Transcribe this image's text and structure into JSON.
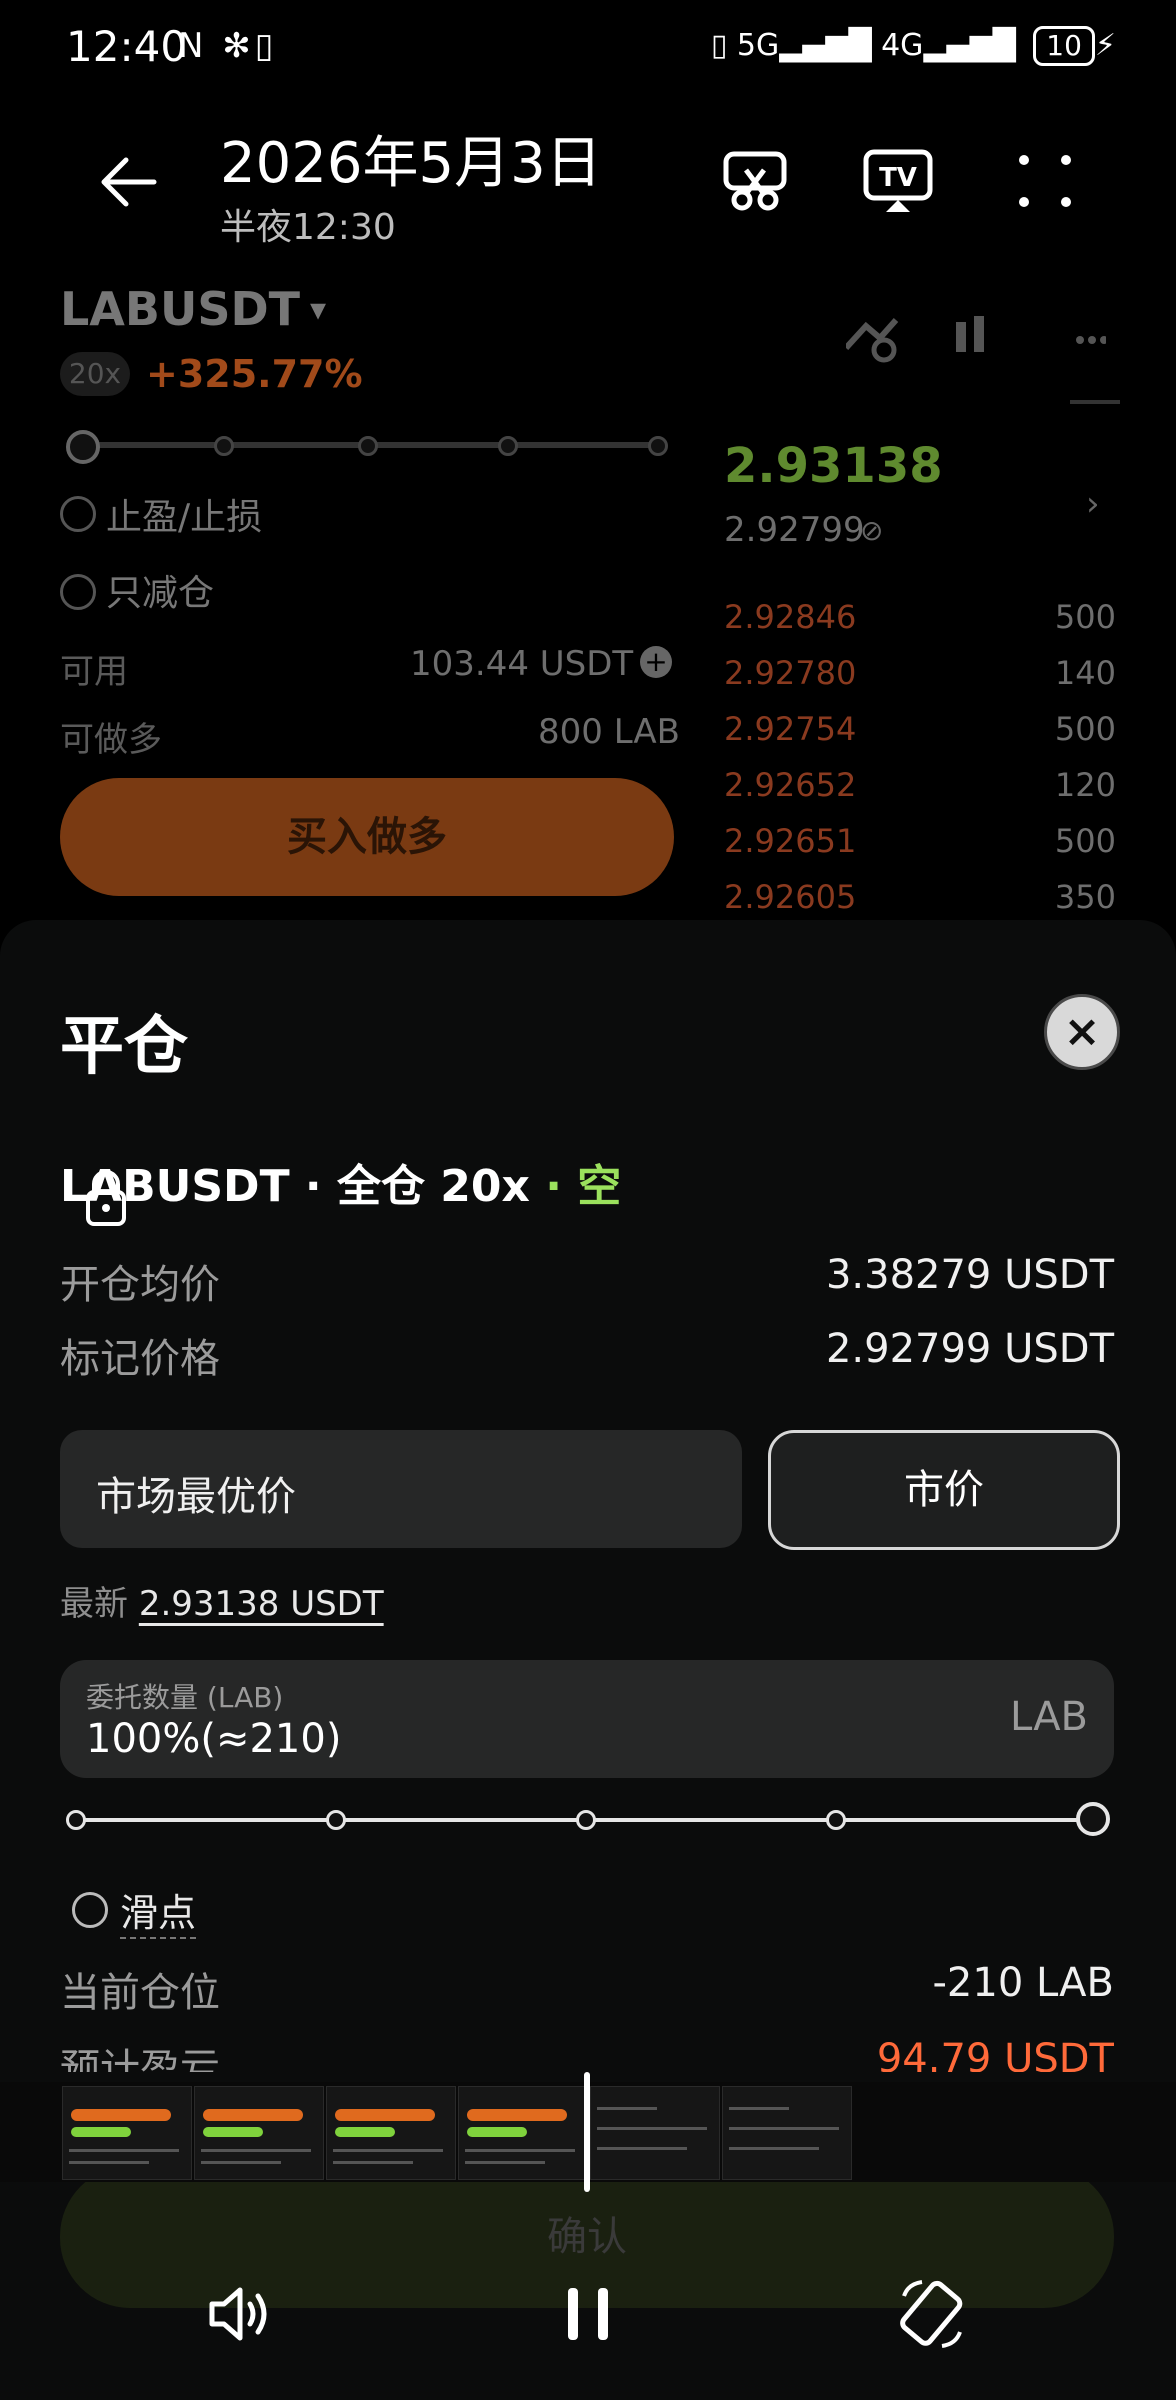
{
  "status_bar": {
    "time": "12:40",
    "left_icons": "N ✻▯",
    "network_5g": "5G",
    "network_4g": "4G",
    "battery": "10"
  },
  "gallery_header": {
    "title": "2026年5月3日",
    "subtitle": "半夜12:30"
  },
  "background": {
    "symbol": "LABUSDT",
    "leverage_badge": "20x",
    "pnl_percent": "+325.77%",
    "tp_sl_label": "止盈/止损",
    "reduce_only_label": "只减仓",
    "available_label": "可用",
    "available_value": "103.44 USDT",
    "max_long_label": "可做多",
    "max_long_value": "800 LAB",
    "buy_long_label": "买入做多",
    "last_price": "2.93138",
    "mark_price": "2.92799",
    "orderbook": [
      {
        "price": "2.92846",
        "qty": "500"
      },
      {
        "price": "2.92780",
        "qty": "140"
      },
      {
        "price": "2.92754",
        "qty": "500"
      },
      {
        "price": "2.92652",
        "qty": "120"
      },
      {
        "price": "2.92651",
        "qty": "500"
      },
      {
        "price": "2.92605",
        "qty": "350"
      }
    ]
  },
  "close_sheet": {
    "title": "平仓",
    "close_icon": "×",
    "symbol": "LABUSDT",
    "margin_mode": "· 全仓 20x",
    "side": "· 空",
    "avg_entry_label": "开仓均价",
    "avg_entry_value": "3.38279 USDT",
    "mark_price_label": "标记价格",
    "mark_price_value": "2.92799 USDT",
    "price_field": "市场最优价",
    "market_button": "市价",
    "latest_label": "最新",
    "latest_value": "2.93138 USDT",
    "qty_label": "委托数量 (LAB)",
    "qty_value": "100%(≈210)",
    "qty_unit": "LAB",
    "slider_percent": 100,
    "slippage_label": "滑点",
    "current_position_label": "当前仓位",
    "current_position_value": "-210 LAB",
    "est_pnl_label": "预计盈亏",
    "est_pnl_value": "94.79 USDT",
    "confirm_label": "确认"
  },
  "colors": {
    "accent_orange": "#e06a1e",
    "short_green": "#9be15d",
    "pnl_red": "#ff6a3a",
    "sheet_bg": "#0b0c0c"
  }
}
